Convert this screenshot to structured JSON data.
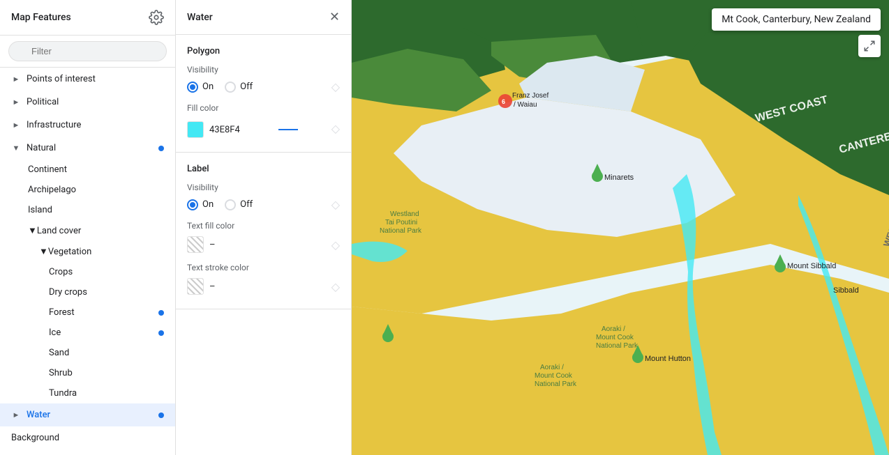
{
  "sidebar": {
    "title": "Map Features",
    "filter_placeholder": "Filter",
    "items": [
      {
        "id": "points-of-interest",
        "label": "Points of interest",
        "level": 0,
        "expanded": false,
        "has_chevron": true,
        "has_dot": false
      },
      {
        "id": "political",
        "label": "Political",
        "level": 0,
        "expanded": false,
        "has_chevron": true,
        "has_dot": false
      },
      {
        "id": "infrastructure",
        "label": "Infrastructure",
        "level": 0,
        "expanded": false,
        "has_chevron": true,
        "has_dot": false
      },
      {
        "id": "natural",
        "label": "Natural",
        "level": 0,
        "expanded": true,
        "has_chevron": true,
        "has_dot": true
      },
      {
        "id": "continent",
        "label": "Continent",
        "level": 1,
        "has_dot": false
      },
      {
        "id": "archipelago",
        "label": "Archipelago",
        "level": 1,
        "has_dot": false
      },
      {
        "id": "island",
        "label": "Island",
        "level": 1,
        "has_dot": false
      },
      {
        "id": "land-cover",
        "label": "Land cover",
        "level": 1,
        "expanded": true,
        "has_chevron": true,
        "has_dot": false
      },
      {
        "id": "vegetation",
        "label": "Vegetation",
        "level": 2,
        "expanded": true,
        "has_chevron": true,
        "has_dot": false
      },
      {
        "id": "crops",
        "label": "Crops",
        "level": 3,
        "has_dot": false
      },
      {
        "id": "dry-crops",
        "label": "Dry crops",
        "level": 3,
        "has_dot": false
      },
      {
        "id": "forest",
        "label": "Forest",
        "level": 3,
        "has_dot": true
      },
      {
        "id": "ice",
        "label": "Ice",
        "level": 3,
        "has_dot": true
      },
      {
        "id": "sand",
        "label": "Sand",
        "level": 3,
        "has_dot": false
      },
      {
        "id": "shrub",
        "label": "Shrub",
        "level": 3,
        "has_dot": false
      },
      {
        "id": "tundra",
        "label": "Tundra",
        "level": 3,
        "has_dot": false
      },
      {
        "id": "water",
        "label": "Water",
        "level": 0,
        "has_dot": true,
        "active": true,
        "has_chevron": true
      },
      {
        "id": "background",
        "label": "Background",
        "level": 0,
        "has_dot": false
      }
    ]
  },
  "panel": {
    "title": "Water",
    "polygon_section": {
      "title": "Polygon",
      "visibility": {
        "label": "Visibility",
        "on_label": "On",
        "off_label": "Off",
        "selected": "on"
      },
      "fill_color": {
        "label": "Fill color",
        "swatch_color": "#43E8F4",
        "value": "43E8F4"
      }
    },
    "label_section": {
      "title": "Label",
      "visibility": {
        "label": "Visibility",
        "on_label": "On",
        "off_label": "Off",
        "selected": "on"
      },
      "text_fill_color": {
        "label": "Text fill color",
        "value": "–"
      },
      "text_stroke_color": {
        "label": "Text stroke color",
        "value": "–"
      }
    }
  },
  "map": {
    "search_value": "Mt Cook, Canterbury, New Zealand"
  }
}
